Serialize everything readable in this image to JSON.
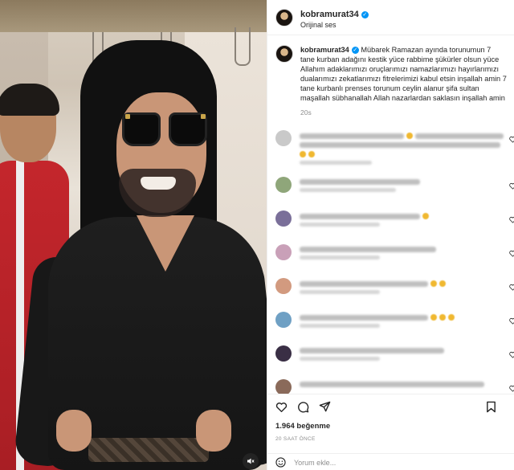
{
  "post": {
    "username": "kobramurat34",
    "audio": "Orijinal ses",
    "caption_text": "Mübarek Ramazan ayında torunumun 7 tane kurban adağını kestik yüce rabbime şükürler olsun yüce Allahım adaklarımızı oruçlarımızı namazlarımızı hayırlarımızı dualarımızı zekatlarımızı fitrelerimizi kabul etsin inşallah amin 7 tane kurbanlı prenses torunum ceylin alanur şifa sultan maşallah sübhanallah Allah nazarlardan saklasın inşallah amin",
    "caption_time": "20s",
    "likes": "1.964 beğenme",
    "time_ago": "20 SAAT ÖNCE",
    "comment_placeholder": "Yorum ekle..."
  },
  "colors": {
    "verified": "#0095f6",
    "text": "#262626",
    "muted": "#8e8e8e",
    "divider": "#efefef"
  },
  "icons": [
    "verified-badge-icon",
    "heart-icon",
    "comment-icon",
    "share-icon",
    "bookmark-icon",
    "emoji-icon",
    "volume-muted-icon"
  ]
}
